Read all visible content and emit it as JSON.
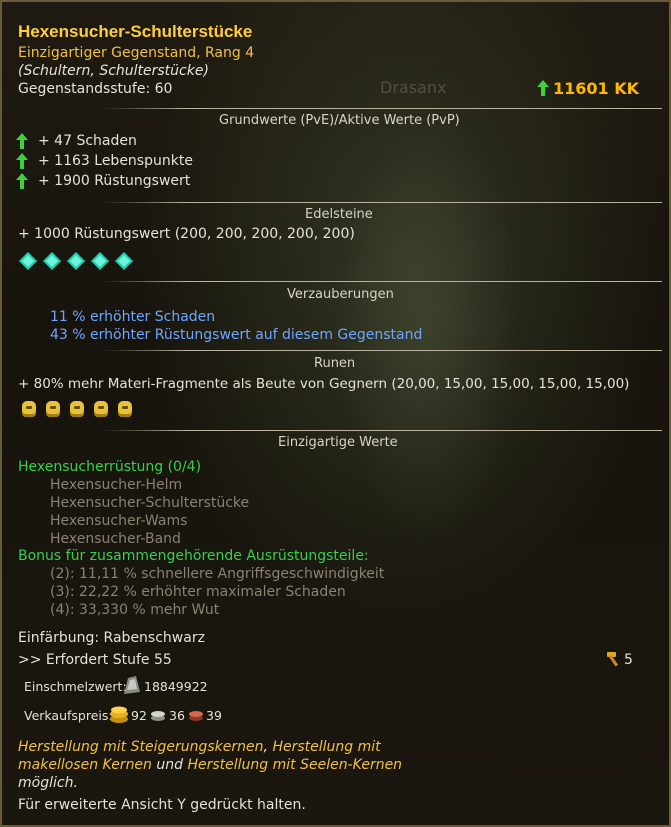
{
  "item": {
    "name": "Hexensucher-Schulterstücke",
    "quality_rank": "Einzigartiger Gegenstand, Rang 4",
    "slot": "(Schultern, Schulterstücke)",
    "item_level": "Gegenstandsstufe: 60",
    "power": "11601 KK"
  },
  "background": {
    "character_name": "Drasanx"
  },
  "base_stats": {
    "header": "Grundwerte (PvE)/Aktive Werte (PvP)",
    "lines": [
      "+ 47 Schaden",
      "+ 1163 Lebenspunkte",
      "+ 1900 Rüstungswert"
    ]
  },
  "gems": {
    "header": "Edelsteine",
    "line": "+ 1000 Rüstungswert (200, 200, 200, 200, 200)",
    "icon": "teal-gem-icon",
    "count": 5
  },
  "enchantments": {
    "header": "Verzauberungen",
    "lines": [
      "11 % erhöhter Schaden",
      "43 % erhöhter Rüstungswert auf diesem Gegenstand"
    ]
  },
  "runes": {
    "header": "Runen",
    "line": "+ 80% mehr Materi-Fragmente als Beute von Gegnern (20,00, 15,00, 15,00, 15,00, 15,00)",
    "icon": "gold-rune-icon",
    "count": 5
  },
  "unique": {
    "header": "Einzigartige Werte",
    "set_name": "Hexensucherrüstung (0/4)",
    "set_items": [
      "Hexensucher-Helm",
      "Hexensucher-Schulterstücke",
      "Hexensucher-Wams",
      "Hexensucher-Band"
    ],
    "bonus_header": "Bonus für zusammengehörende Ausrüstungsteile:",
    "bonuses": [
      "(2): 11,11 % schnellere Angriffsgeschwindigkeit",
      "(3): 22,22 % erhöhter maximaler Schaden",
      "(4): 33,330 % mehr Wut"
    ]
  },
  "dye": "Einfärbung: Rabenschwarz",
  "requirement": ">> Erfordert Stufe 55",
  "upgrade_count": "5",
  "melt_value": {
    "label": "Einschmelzwert:",
    "value": "18849922"
  },
  "sell_price": {
    "label": "Verkaufspreis:",
    "gold": "92",
    "silver": "36",
    "copper": "39"
  },
  "crafting": {
    "line1_a": "Herstellung mit Steigerungskernen",
    "line1_b": ", ",
    "line1_c": "Herstellung mit",
    "line2_a": "makellosen Kernen",
    "line2_b": " und ",
    "line2_c": "Herstellung mit Seelen-Kernen",
    "line3": "möglich."
  },
  "hint": "Für erweiterte Ansicht Y gedrückt halten.",
  "colors": {
    "title": "#ffcf3a",
    "blue": "#6fa6ff",
    "green": "#37d04a",
    "power": "#ffb800"
  }
}
